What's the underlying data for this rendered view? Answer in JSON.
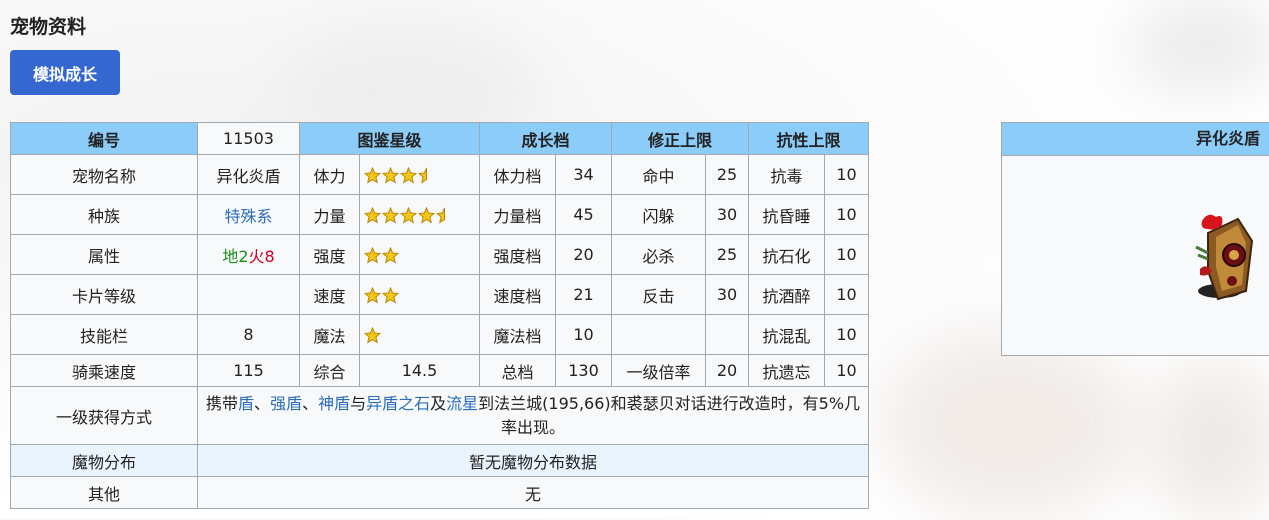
{
  "section_title": "宠物资料",
  "simulate_button": "模拟成长",
  "headers": {
    "id_label": "编号",
    "id_value": "11503",
    "star_title": "图鉴星级",
    "growth_title": "成长档",
    "correction_title": "修正上限",
    "resist_title": "抗性上限"
  },
  "rows": {
    "name": {
      "label": "宠物名称",
      "value": "异化炎盾",
      "stat": "体力",
      "stars": 3.5,
      "gear": "体力档",
      "gear_value": "34",
      "corr": "命中",
      "corr_value": "25",
      "res": "抗毒",
      "res_value": "10"
    },
    "race": {
      "label": "种族",
      "value": "特殊系",
      "stat": "力量",
      "stars": 4.5,
      "gear": "力量档",
      "gear_value": "45",
      "corr": "闪躲",
      "corr_value": "30",
      "res": "抗昏睡",
      "res_value": "10"
    },
    "attr": {
      "label": "属性",
      "attr_earth": "地2",
      "attr_fire": "火8",
      "stat": "强度",
      "stars": 2,
      "gear": "强度档",
      "gear_value": "20",
      "corr": "必杀",
      "corr_value": "25",
      "res": "抗石化",
      "res_value": "10"
    },
    "card": {
      "label": "卡片等级",
      "value": "",
      "stat": "速度",
      "stars": 2,
      "gear": "速度档",
      "gear_value": "21",
      "corr": "反击",
      "corr_value": "30",
      "res": "抗酒醉",
      "res_value": "10"
    },
    "skill": {
      "label": "技能栏",
      "value": "8",
      "stat": "魔法",
      "stars": 1,
      "gear": "魔法档",
      "gear_value": "10",
      "corr": "",
      "corr_value": "",
      "res": "抗混乱",
      "res_value": "10"
    },
    "ride": {
      "label": "骑乘速度",
      "value": "115",
      "stat": "综合",
      "stat_value": "14.5",
      "gear": "总档",
      "gear_value": "130",
      "corr": "一级倍率",
      "corr_value": "20",
      "res": "抗遗忘",
      "res_value": "10"
    }
  },
  "obtain": {
    "label": "一级获得方式",
    "t1": "携带",
    "l1": "盾",
    "t2": "、",
    "l2": "强盾",
    "t3": "、",
    "l3": "神盾",
    "t4": "与",
    "l4": "异盾之石",
    "t5": "及",
    "l5": "流星",
    "t6": "到法兰城(195,66)和裘瑟贝对话进行改造时，有5%几率出现。"
  },
  "distribution": {
    "label": "魔物分布",
    "value": "暂无魔物分布数据"
  },
  "other": {
    "label": "其他",
    "value": "无"
  },
  "side_panel": {
    "title": "异化炎盾"
  },
  "colors": {
    "header_bg": "#8cccf8",
    "button_bg": "#3567d1",
    "link": "#2a6ebb",
    "earth": "#1a8f1a",
    "fire": "#d0021b",
    "star": "#f5c518"
  }
}
